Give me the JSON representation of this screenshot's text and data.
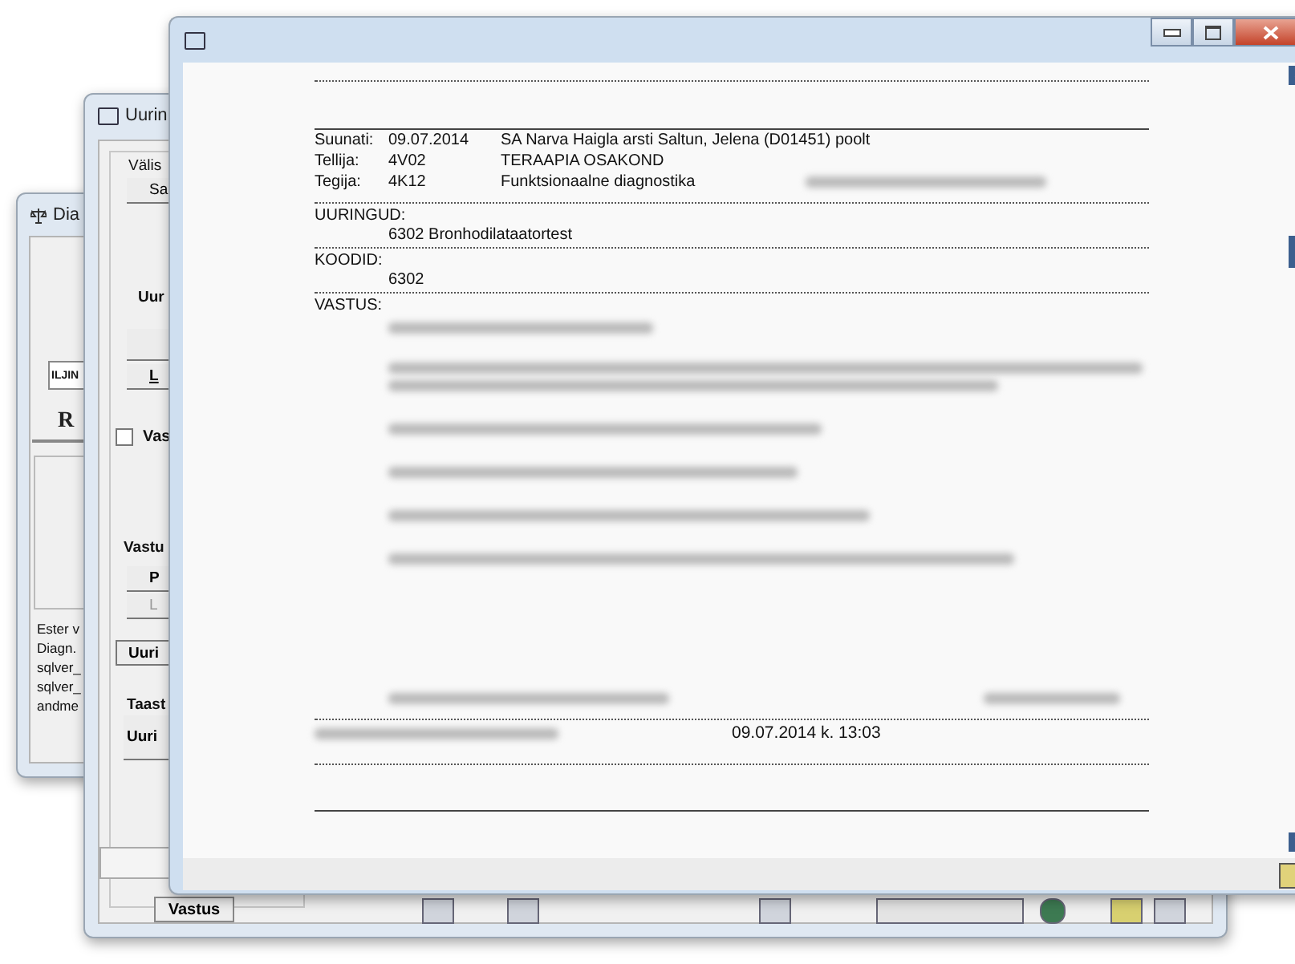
{
  "diag_window": {
    "title": "Dia",
    "name_field": "ILJIN",
    "big_button": "R",
    "info_lines": [
      "Ester v",
      "Diagn.",
      "sqlver_",
      "sqlver_",
      "andme"
    ]
  },
  "study_window": {
    "title": "Uurin",
    "tab_label": "Välis",
    "sa_button": "Sa",
    "section_label": "Uur",
    "l_button": "L",
    "checkbox": {
      "label": "Vas",
      "checked": false
    },
    "vastu_label": "Vastu",
    "p_button": "P",
    "l2_button": {
      "label": "L",
      "disabled": true
    },
    "uuri_button": "Uuri",
    "taast_label": "Taast",
    "uuri2_button": "Uuri",
    "vastus_button": "Vastus"
  },
  "report_window": {
    "header_rows": [
      {
        "label": "Suunati:",
        "code": "09.07.2014",
        "text": "SA Narva Haigla arsti Saltun, Jelena (D01451) poolt"
      },
      {
        "label": "Tellija:",
        "code": "4V02",
        "text": "TERAAPIA OSAKOND"
      },
      {
        "label": "Tegija:",
        "code": "4K12",
        "text": "Funktsionaalne diagnostika"
      }
    ],
    "sections": [
      {
        "heading": "UURINGUD:",
        "value": "6302 Bronhodilataatortest"
      },
      {
        "heading": "KOODID:",
        "value": "6302"
      },
      {
        "heading": "VASTUS:"
      }
    ],
    "performed_datetime": "09.07.2014 k. 13:03"
  }
}
